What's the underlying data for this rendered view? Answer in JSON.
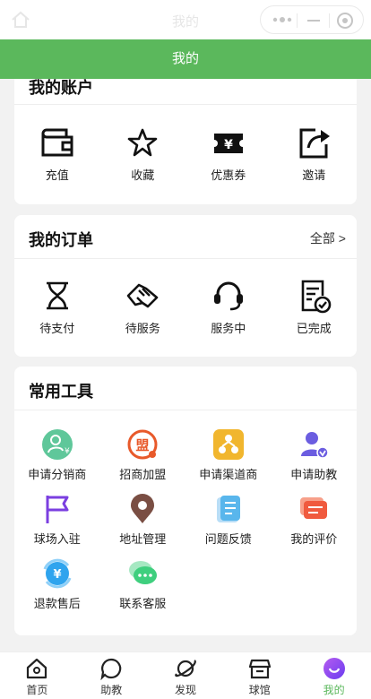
{
  "system_bar": {
    "title": "我的"
  },
  "header": {
    "title": "我的"
  },
  "account": {
    "title": "我的账户",
    "items": [
      {
        "label": "充值",
        "icon": "wallet-icon"
      },
      {
        "label": "收藏",
        "icon": "star-icon"
      },
      {
        "label": "优惠券",
        "icon": "coupon-icon"
      },
      {
        "label": "邀请",
        "icon": "share-icon"
      }
    ]
  },
  "orders": {
    "title": "我的订单",
    "more_label": "全部 >",
    "items": [
      {
        "label": "待支付",
        "icon": "hourglass-icon"
      },
      {
        "label": "待服务",
        "icon": "handshake-icon"
      },
      {
        "label": "服务中",
        "icon": "headset-icon"
      },
      {
        "label": "已完成",
        "icon": "checklist-icon"
      }
    ]
  },
  "tools": {
    "title": "常用工具",
    "items": [
      {
        "label": "申请分销商",
        "icon": "distributor-icon"
      },
      {
        "label": "招商加盟",
        "icon": "franchise-icon"
      },
      {
        "label": "申请渠道商",
        "icon": "channel-icon"
      },
      {
        "label": "申请助教",
        "icon": "assistant-icon"
      },
      {
        "label": "球场入驻",
        "icon": "flag-icon"
      },
      {
        "label": "地址管理",
        "icon": "location-pin-icon"
      },
      {
        "label": "问题反馈",
        "icon": "feedback-doc-icon"
      },
      {
        "label": "我的评价",
        "icon": "comment-icon"
      },
      {
        "label": "退款售后",
        "icon": "refund-icon"
      },
      {
        "label": "联系客服",
        "icon": "chat-icon"
      }
    ]
  },
  "tabbar": {
    "items": [
      {
        "label": "首页",
        "icon": "home-icon"
      },
      {
        "label": "助教",
        "icon": "chat-bubble-icon"
      },
      {
        "label": "发现",
        "icon": "planet-icon"
      },
      {
        "label": "球馆",
        "icon": "store-icon"
      },
      {
        "label": "我的",
        "icon": "profile-icon",
        "active": true
      }
    ]
  },
  "colors": {
    "accent": "#5bb85c",
    "orange": "#e8592a",
    "purple": "#7b3fe0"
  }
}
